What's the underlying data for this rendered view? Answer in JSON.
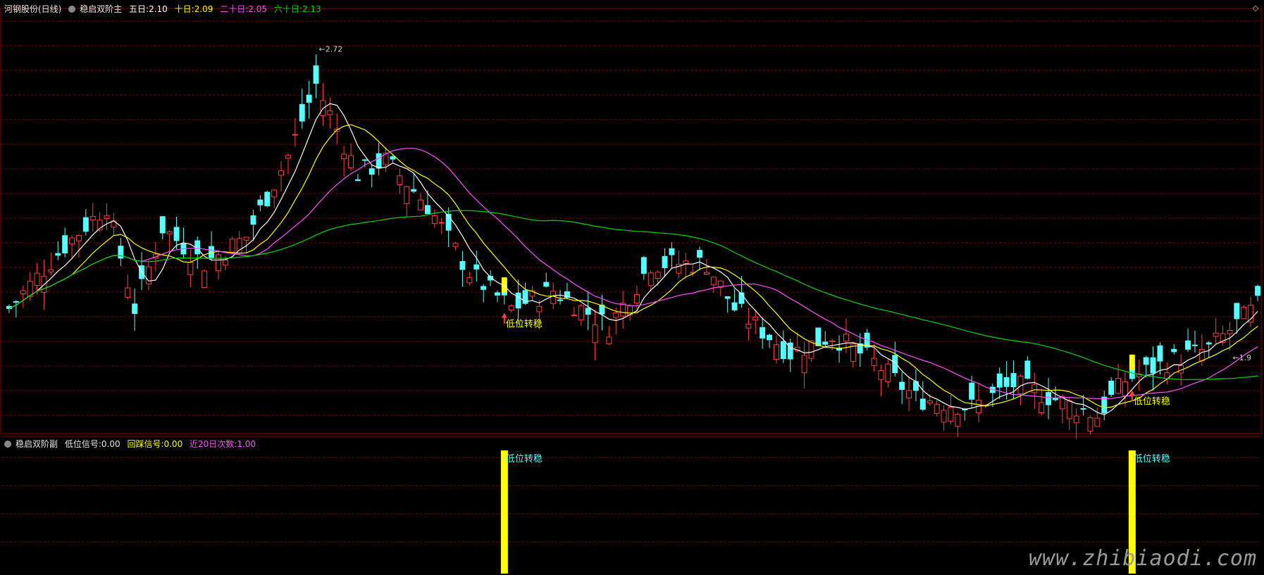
{
  "header": {
    "stock_name": "河钢股份(日线)",
    "main_indicator": "稳启双阶主",
    "ma5_label": "五日:",
    "ma5_value": "2.10",
    "ma10_label": "十日:",
    "ma10_value": "2.09",
    "ma20_label": "二十日:",
    "ma20_value": "2.05",
    "ma60_label": "六十日:",
    "ma60_value": "2.13"
  },
  "sub_header": {
    "indicator": "稳启双阶副",
    "signal_label": "低位信号:",
    "signal_value": "0.00",
    "pullback_label": "回踩信号:",
    "pullback_value": "0.00",
    "count_label": "近20日次数:",
    "count_value": "1.00"
  },
  "watermark": "www.zhibiaodi.com",
  "colors": {
    "up": "#ff3d3d",
    "down": "#54ffff",
    "ma5": "#ffffff",
    "ma10": "#ffff00",
    "ma20": "#ff4dff",
    "ma60": "#00d800",
    "signal": "#ffff00",
    "grid": "#7a0000",
    "signal_text": "#ffff00",
    "sub_signal_text": "#54ffff",
    "arrow": "#ff3d3d"
  },
  "chart_data": [
    {
      "type": "candlestick",
      "title": "河钢股份(日线)",
      "ylim": [
        1.85,
        2.78
      ],
      "grid": true,
      "annotations": [
        {
          "index": 44,
          "text": "2.72",
          "type": "high"
        },
        {
          "index": 175,
          "text": "1.9",
          "type": "low"
        }
      ],
      "signals": [
        {
          "index": 71,
          "label": "低位转稳"
        },
        {
          "index": 161,
          "label": "低位转稳"
        }
      ],
      "ma_values": {
        "ma5": 2.1,
        "ma10": 2.09,
        "ma20": 2.05,
        "ma60": 2.13
      }
    },
    {
      "type": "bar",
      "title": "稳启双阶副",
      "series": [
        {
          "name": "低位信号",
          "bars": [
            {
              "index": 71,
              "value": 1
            },
            {
              "index": 161,
              "value": 1
            }
          ]
        }
      ],
      "labels": [
        "低位转稳",
        "低位转稳"
      ]
    }
  ]
}
